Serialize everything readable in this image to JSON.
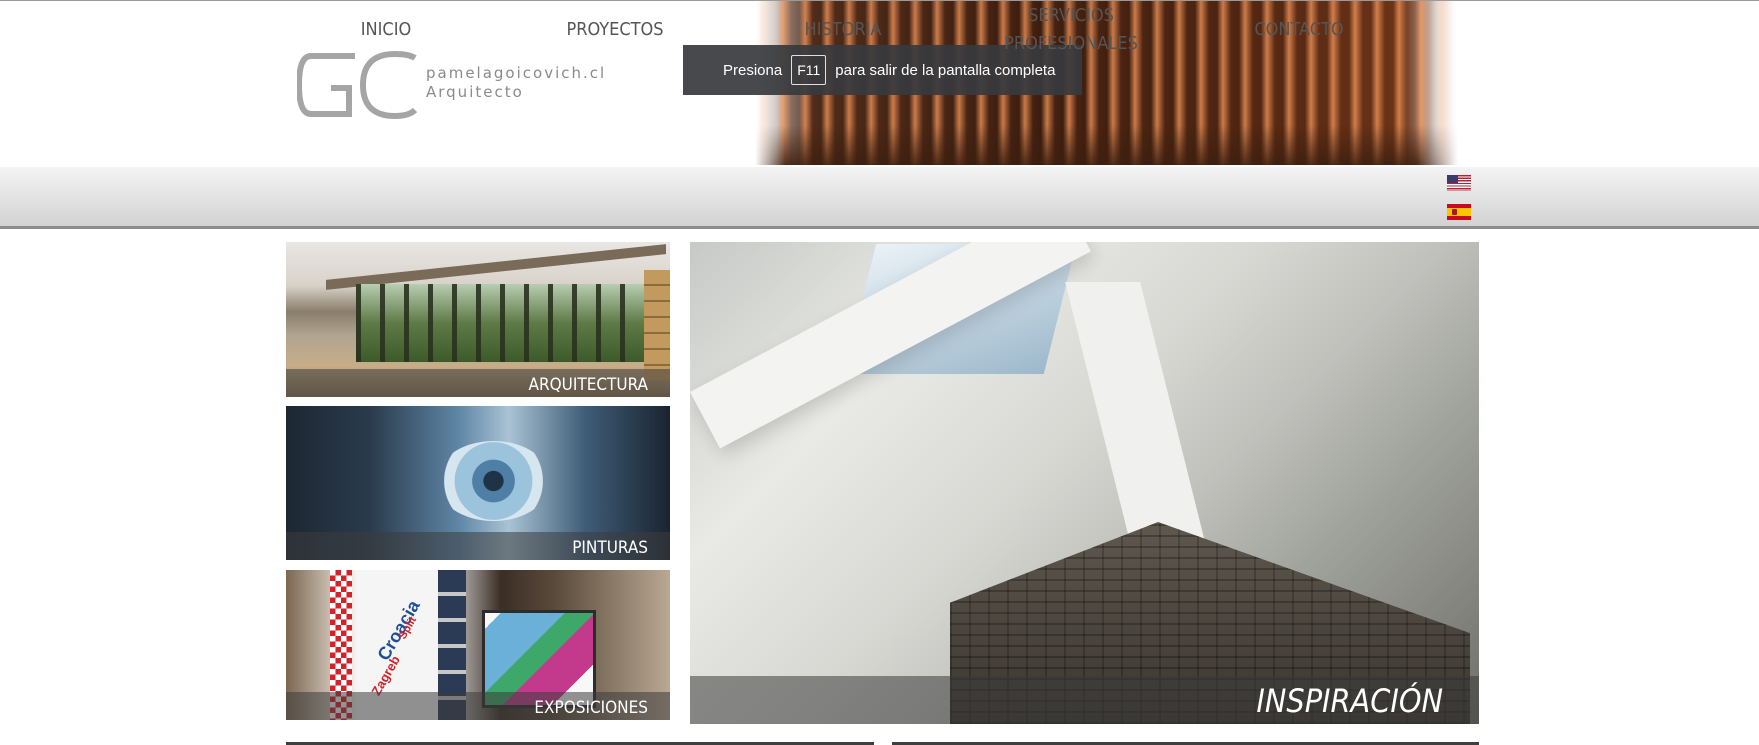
{
  "header": {
    "logo_domain": "pamelagoicovich.cl",
    "logo_role": "Arquitecto"
  },
  "fullscreen_notice": {
    "prefix": "Presiona",
    "key": "F11",
    "suffix": "para salir de la pantalla completa"
  },
  "nav": {
    "items": [
      {
        "label": "INICIO"
      },
      {
        "label": "PROYECTOS"
      },
      {
        "label": "HISTORIA"
      },
      {
        "label_line1": "SERVICIOS",
        "label_line2": "PROFESIONALES"
      },
      {
        "label": "CONTACTO"
      }
    ],
    "languages": [
      {
        "icon": "us-flag-icon"
      },
      {
        "icon": "spain-flag-icon"
      }
    ]
  },
  "tiles": {
    "arquitectura": "ARQUITECTURA",
    "pinturas": "PINTURAS",
    "exposiciones": "EXPOSICIONES",
    "inspiracion": "INSPIRACIÓN"
  },
  "exhibit_poster": {
    "words": [
      "Croacia",
      "Zagreb",
      "Split"
    ]
  },
  "colors": {
    "nav_text": "#555555",
    "logo_gray": "#8a8a8a",
    "caption_text": "#ffffff"
  }
}
